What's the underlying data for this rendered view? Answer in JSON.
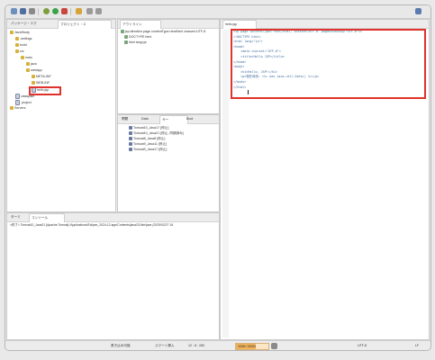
{
  "toolbar": {
    "icons": [
      "new-icon",
      "save-icon",
      "print-icon",
      "run-icon",
      "debug-icon",
      "server-icon",
      "search-icon",
      "back-icon",
      "forward-icon"
    ]
  },
  "left_panel": {
    "tab_explorer": "パッケージ・エク",
    "tab_project": "プロジェクト・エ",
    "tree": [
      "JavaStudy",
      ".settings",
      "build",
      "src",
      "main",
      "java",
      "webapp",
      "META-INF",
      "WEB-INF",
      "hello.jsp",
      "classpath",
      ".project",
      "Servers"
    ]
  },
  "outline_panel": {
    "tab": "アウトライン",
    "rows": [
      "jsp:directive.page contentType=text/html charset=UTF-8",
      "DOCTYPE html",
      "html lang=ja"
    ]
  },
  "servers_panel": {
    "tabs": [
      "問題",
      "Data",
      "サー",
      "Boot"
    ],
    "items": [
      "Tomcat10_Java17 [停止]",
      "Tomcat10_Java21 [停止, 同期済み]",
      "Tomcat8_Java8 [停止]",
      "Tomcat9_Java11 [停止]",
      "Tomcat9_Java17 [停止]"
    ]
  },
  "editor": {
    "tab": "hello.jsp",
    "lines": [
      "<%@ page contentType=\"text/html; charset=UTF-8\" pageEncoding=\"UTF-8\"%>",
      "<!DOCTYPE html>",
      "<html lang=\"ja\">",
      "<head>",
      "    <meta charset=\"UTF-8\">",
      "    <title>Hello JSP</title>",
      "</head>",
      "<body>",
      "    <h1>Hello, JSP!</h1>",
      "    <p>現在時刻: <%= new java.util.Date() %></p>",
      "</body>",
      "</html>"
    ]
  },
  "console": {
    "tab_terminal": "ターミ",
    "tab_console": "コンソール",
    "text": "<終了> Tomcat10_Java21 [Apache Tomcat] /Applications/Eclipse_2024-12.app/Contents/java/21/bin/java (2025/02/27 16"
  },
  "status_bar": {
    "writable": "書き込み可能",
    "insert": "スマート挿入",
    "position": "12 : 8 : 283",
    "memory": "330M / 550M",
    "encoding": "UTF-8",
    "line_sep": "LF"
  },
  "colors": {
    "highlight": "#e0322c",
    "memory_bar": "#f2b45a"
  }
}
